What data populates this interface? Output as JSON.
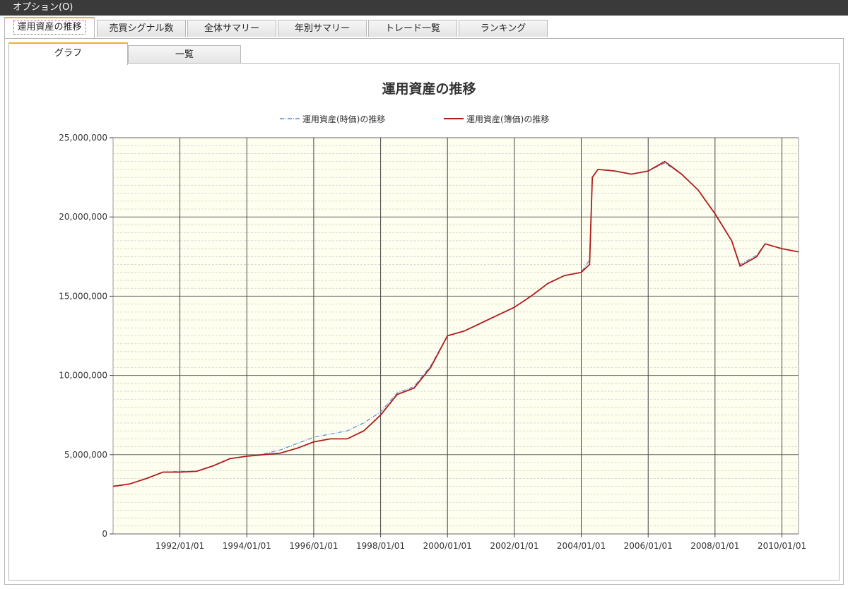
{
  "menu": {
    "options_label": "オプション(O)"
  },
  "main_tabs": [
    {
      "label": "運用資産の推移",
      "active": true
    },
    {
      "label": "売買シグナル数",
      "active": false
    },
    {
      "label": "全体サマリー",
      "active": false
    },
    {
      "label": "年別サマリー",
      "active": false
    },
    {
      "label": "トレード一覧",
      "active": false
    },
    {
      "label": "ランキング",
      "active": false
    }
  ],
  "sub_tabs": [
    {
      "label": "グラフ",
      "active": true
    },
    {
      "label": "一覧",
      "active": false
    }
  ],
  "colors": {
    "market_series": "#5a8ad6",
    "book_series": "#b01c1c",
    "plot_bg": "#fffff0"
  },
  "chart_data": {
    "type": "line",
    "title": "運用資産の推移",
    "xlabel": "",
    "ylabel": "",
    "x_range": [
      "1990/01/01",
      "2010/07/01"
    ],
    "ylim": [
      0,
      25000000
    ],
    "y_ticks": [
      0,
      5000000,
      10000000,
      15000000,
      20000000,
      25000000
    ],
    "y_tick_labels": [
      "0",
      "5,000,000",
      "10,000,000",
      "15,000,000",
      "20,000,000",
      "25,000,000"
    ],
    "x_ticks": [
      "1992/01/01",
      "1994/01/01",
      "1996/01/01",
      "1998/01/01",
      "2000/01/01",
      "2002/01/01",
      "2004/01/01",
      "2006/01/01",
      "2008/01/01",
      "2010/01/01"
    ],
    "x_tick_labels": [
      "1992/01/01",
      "1994/01/01",
      "1996/01/01",
      "1998/01/01",
      "2000/01/01",
      "2002/01/01",
      "2004/01/01",
      "2006/01/01",
      "2008/01/01",
      "2010/01/01"
    ],
    "grid": true,
    "legend_position": "top",
    "series": [
      {
        "name": "運用資産(時価)の推移",
        "style": "dash-dot",
        "points": [
          [
            "1990/01/01",
            3000000
          ],
          [
            "1990/07/01",
            3150000
          ],
          [
            "1991/01/01",
            3500000
          ],
          [
            "1991/07/01",
            3900000
          ],
          [
            "1992/01/01",
            3950000
          ],
          [
            "1992/07/01",
            3950000
          ],
          [
            "1993/01/01",
            4300000
          ],
          [
            "1993/07/01",
            4750000
          ],
          [
            "1994/01/01",
            4900000
          ],
          [
            "1994/07/01",
            5050000
          ],
          [
            "1995/01/01",
            5300000
          ],
          [
            "1995/07/01",
            5700000
          ],
          [
            "1996/01/01",
            6100000
          ],
          [
            "1996/07/01",
            6300000
          ],
          [
            "1997/01/01",
            6500000
          ],
          [
            "1997/07/01",
            7000000
          ],
          [
            "1998/01/01",
            7700000
          ],
          [
            "1998/07/01",
            8900000
          ],
          [
            "1999/01/01",
            9300000
          ],
          [
            "1999/07/01",
            10600000
          ],
          [
            "2000/01/01",
            12500000
          ],
          [
            "2000/07/01",
            12800000
          ],
          [
            "2001/01/01",
            13300000
          ],
          [
            "2001/07/01",
            13800000
          ],
          [
            "2002/01/01",
            14300000
          ],
          [
            "2002/07/01",
            15000000
          ],
          [
            "2003/01/01",
            15800000
          ],
          [
            "2003/07/01",
            16300000
          ],
          [
            "2004/01/01",
            16500000
          ],
          [
            "2004/04/01",
            17300000
          ],
          [
            "2004/05/01",
            22500000
          ],
          [
            "2004/07/01",
            23000000
          ],
          [
            "2005/01/01",
            22900000
          ],
          [
            "2005/07/01",
            22700000
          ],
          [
            "2006/01/01",
            22900000
          ],
          [
            "2006/07/01",
            23400000
          ],
          [
            "2007/01/01",
            22700000
          ],
          [
            "2007/07/01",
            21700000
          ],
          [
            "2008/01/01",
            20200000
          ],
          [
            "2008/07/01",
            18500000
          ],
          [
            "2008/10/01",
            17000000
          ],
          [
            "2009/01/01",
            17300000
          ],
          [
            "2009/04/01",
            17600000
          ],
          [
            "2009/07/01",
            18300000
          ],
          [
            "2010/01/01",
            18000000
          ],
          [
            "2010/07/01",
            17800000
          ]
        ]
      },
      {
        "name": "運用資産(簿価)の推移",
        "style": "solid",
        "points": [
          [
            "1990/01/01",
            3000000
          ],
          [
            "1990/07/01",
            3150000
          ],
          [
            "1991/01/01",
            3500000
          ],
          [
            "1991/07/01",
            3900000
          ],
          [
            "1992/01/01",
            3900000
          ],
          [
            "1992/07/01",
            3950000
          ],
          [
            "1993/01/01",
            4300000
          ],
          [
            "1993/07/01",
            4750000
          ],
          [
            "1994/01/01",
            4900000
          ],
          [
            "1994/07/01",
            5000000
          ],
          [
            "1995/01/01",
            5100000
          ],
          [
            "1995/07/01",
            5400000
          ],
          [
            "1996/01/01",
            5800000
          ],
          [
            "1996/07/01",
            6000000
          ],
          [
            "1997/01/01",
            6000000
          ],
          [
            "1997/07/01",
            6500000
          ],
          [
            "1998/01/01",
            7500000
          ],
          [
            "1998/07/01",
            8800000
          ],
          [
            "1999/01/01",
            9200000
          ],
          [
            "1999/07/01",
            10500000
          ],
          [
            "2000/01/01",
            12500000
          ],
          [
            "2000/07/01",
            12800000
          ],
          [
            "2001/01/01",
            13300000
          ],
          [
            "2001/07/01",
            13800000
          ],
          [
            "2002/01/01",
            14300000
          ],
          [
            "2002/07/01",
            15000000
          ],
          [
            "2003/01/01",
            15800000
          ],
          [
            "2003/07/01",
            16300000
          ],
          [
            "2004/01/01",
            16500000
          ],
          [
            "2004/04/01",
            17000000
          ],
          [
            "2004/05/01",
            22500000
          ],
          [
            "2004/07/01",
            23000000
          ],
          [
            "2005/01/01",
            22900000
          ],
          [
            "2005/07/01",
            22700000
          ],
          [
            "2006/01/01",
            22900000
          ],
          [
            "2006/07/01",
            23500000
          ],
          [
            "2007/01/01",
            22700000
          ],
          [
            "2007/07/01",
            21700000
          ],
          [
            "2008/01/01",
            20200000
          ],
          [
            "2008/07/01",
            18500000
          ],
          [
            "2008/10/01",
            16900000
          ],
          [
            "2009/01/01",
            17200000
          ],
          [
            "2009/04/01",
            17500000
          ],
          [
            "2009/07/01",
            18300000
          ],
          [
            "2010/01/01",
            18000000
          ],
          [
            "2010/07/01",
            17800000
          ]
        ]
      }
    ]
  }
}
